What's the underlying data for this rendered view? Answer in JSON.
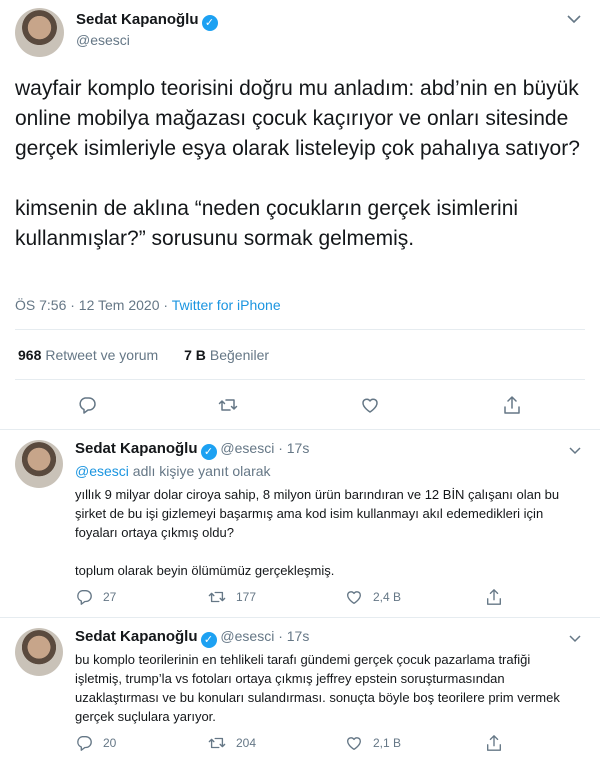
{
  "main_tweet": {
    "author_name": "Sedat Kapanoğlu",
    "handle": "@esesci",
    "text_p1": "wayfair komplo teorisini doğru mu anladım: abd’nin en büyük online mobilya mağazası çocuk kaçırıyor ve onları sitesinde gerçek isimleriyle eşya olarak listeleyip çok pahalıya satıyor?",
    "text_p2": "kimsenin de aklına “neden çocukların gerçek isimlerini kullanmışlar?” sorusunu sormak gelmemiş.",
    "timestamp": "ÖS 7:56 · 12 Tem 2020 · ",
    "source": "Twitter for iPhone",
    "retweets_count": "968",
    "retweets_label": "Retweet ve yorum",
    "likes_count": "7 B",
    "likes_label": "Beğeniler"
  },
  "replies": [
    {
      "author_name": "Sedat Kapanoğlu",
      "handle": "@esesci",
      "time": "· 17s",
      "replying_mention": "@esesci",
      "replying_suffix": " adlı kişiye yanıt olarak",
      "text_p1": "yıllık 9 milyar dolar ciroya sahip, 8 milyon ürün barındıran ve 12 BİN çalışanı olan bu şirket de bu işi gizlemeyi başarmış ama kod isim kullanmayı akıl edemedikleri için foyaları ortaya çıkmış oldu?",
      "text_p2": "toplum olarak beyin ölümümüz gerçekleşmiş.",
      "replies": "27",
      "retweets": "177",
      "likes": "2,4 B"
    },
    {
      "author_name": "Sedat Kapanoğlu",
      "handle": "@esesci",
      "time": "· 17s",
      "text_p1": "bu komplo teorilerinin en tehlikeli tarafı gündemi gerçek çocuk pazarlama trafiği işletmiş, trump’la vs fotoları ortaya çıkmış jeffrey epstein soruşturmasından uzaklaştırması ve bu konuları sulandırması. sonuçta böyle boş teorilere prim vermek gerçek suçlulara yarıyor.",
      "replies": "20",
      "retweets": "204",
      "likes": "2,1 B"
    }
  ],
  "icons": {
    "reply": "reply-icon",
    "retweet": "retweet-icon",
    "like": "heart-icon",
    "share": "share-icon",
    "verified": "verified-badge-icon",
    "more": "chevron-down-icon"
  },
  "colors": {
    "link_blue": "#1b95e0",
    "verified_blue": "#1da1f2",
    "secondary_text": "#657786",
    "primary_text": "#14171a",
    "divider": "#e6ecf0"
  }
}
